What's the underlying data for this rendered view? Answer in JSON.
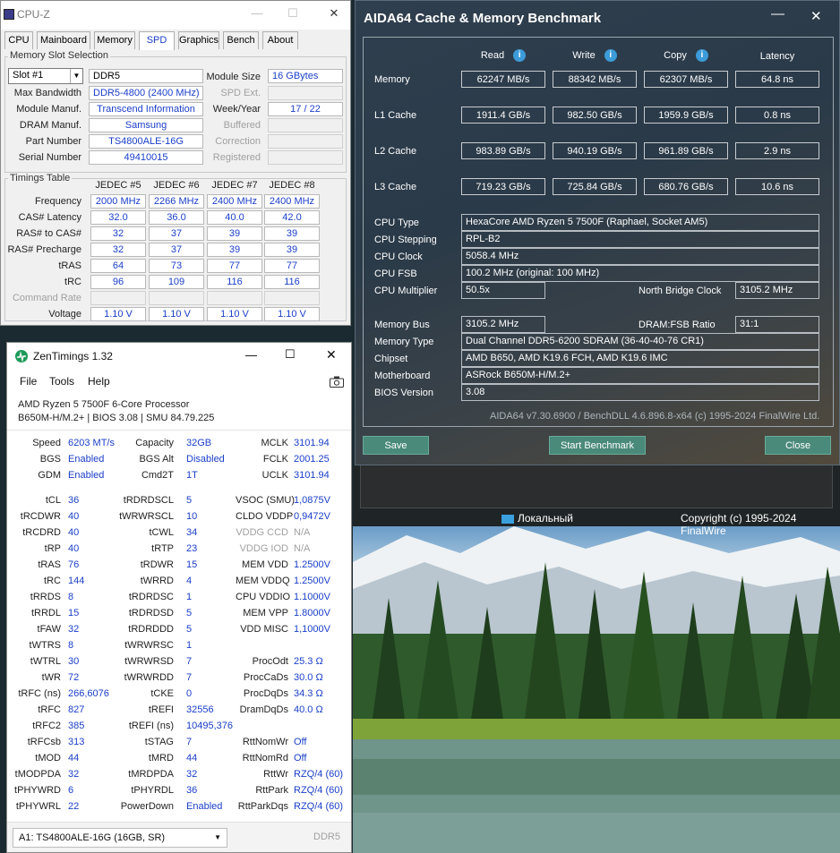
{
  "cpuz": {
    "title": "CPU-Z",
    "tabs": [
      "CPU",
      "Mainboard",
      "Memory",
      "SPD",
      "Graphics",
      "Bench",
      "About"
    ],
    "slot_group": "Memory Slot Selection",
    "slot": "Slot #1",
    "module_type": "DDR5",
    "labels": {
      "module_size": "Module Size",
      "max_bw": "Max Bandwidth",
      "spd_ext": "SPD Ext.",
      "manuf": "Module Manuf.",
      "week": "Week/Year",
      "dram": "DRAM Manuf.",
      "buffered": "Buffered",
      "part": "Part Number",
      "correction": "Correction",
      "serial": "Serial Number",
      "registered": "Registered"
    },
    "module_size": "16 GBytes",
    "max_bw": "DDR5-4800 (2400 MHz)",
    "manuf": "Transcend Information",
    "week": "17 / 22",
    "dram": "Samsung",
    "part": "TS4800ALE-16G",
    "serial": "49410015",
    "timings_group": "Timings Table",
    "cols": [
      "JEDEC #5",
      "JEDEC #6",
      "JEDEC #7",
      "JEDEC #8"
    ],
    "rows": [
      {
        "label": "Frequency",
        "vals": [
          "2000 MHz",
          "2266 MHz",
          "2400 MHz",
          "2400 MHz"
        ]
      },
      {
        "label": "CAS# Latency",
        "vals": [
          "32.0",
          "36.0",
          "40.0",
          "42.0"
        ]
      },
      {
        "label": "RAS# to CAS#",
        "vals": [
          "32",
          "37",
          "39",
          "39"
        ]
      },
      {
        "label": "RAS# Precharge",
        "vals": [
          "32",
          "37",
          "39",
          "39"
        ]
      },
      {
        "label": "tRAS",
        "vals": [
          "64",
          "73",
          "77",
          "77"
        ]
      },
      {
        "label": "tRC",
        "vals": [
          "96",
          "109",
          "116",
          "116"
        ]
      },
      {
        "label": "Command Rate",
        "vals": [
          "",
          "",
          "",
          ""
        ]
      },
      {
        "label": "Voltage",
        "vals": [
          "1.10 V",
          "1.10 V",
          "1.10 V",
          "1.10 V"
        ]
      }
    ]
  },
  "aida": {
    "title": "AIDA64 Cache & Memory Benchmark",
    "headers": [
      "Read",
      "Write",
      "Copy",
      "Latency"
    ],
    "bench": [
      {
        "label": "Memory",
        "vals": [
          "62247 MB/s",
          "88342 MB/s",
          "62307 MB/s",
          "64.8 ns"
        ]
      },
      {
        "label": "L1 Cache",
        "vals": [
          "1911.4 GB/s",
          "982.50 GB/s",
          "1959.9 GB/s",
          "0.8 ns"
        ]
      },
      {
        "label": "L2 Cache",
        "vals": [
          "983.89 GB/s",
          "940.19 GB/s",
          "961.89 GB/s",
          "2.9 ns"
        ]
      },
      {
        "label": "L3 Cache",
        "vals": [
          "719.23 GB/s",
          "725.84 GB/s",
          "680.76 GB/s",
          "10.6 ns"
        ]
      }
    ],
    "cpu_type_l": "CPU Type",
    "cpu_type": "HexaCore AMD Ryzen 5 7500F  (Raphael, Socket AM5)",
    "cpu_step_l": "CPU Stepping",
    "cpu_step": "RPL-B2",
    "cpu_clock_l": "CPU Clock",
    "cpu_clock": "5058.4 MHz",
    "cpu_fsb_l": "CPU FSB",
    "cpu_fsb": "100.2 MHz  (original: 100 MHz)",
    "cpu_mult_l": "CPU Multiplier",
    "cpu_mult": "50.5x",
    "nb_l": "North Bridge Clock",
    "nb": "3105.2 MHz",
    "mem_bus_l": "Memory Bus",
    "mem_bus": "3105.2 MHz",
    "ratio_l": "DRAM:FSB Ratio",
    "ratio": "31:1",
    "mem_type_l": "Memory Type",
    "mem_type": "Dual Channel DDR5-6200 SDRAM  (36-40-40-76 CR1)",
    "chipset_l": "Chipset",
    "chipset": "AMD B650, AMD K19.6 FCH, AMD K19.6 IMC",
    "mobo_l": "Motherboard",
    "mobo": "ASRock B650M-H/M.2+",
    "bios_l": "BIOS Version",
    "bios": "3.08",
    "version": "AIDA64 v7.30.6900 / BenchDLL 4.6.896.8-x64  (c) 1995-2024 FinalWire Ltd.",
    "save": "Save",
    "start": "Start Benchmark",
    "close": "Close"
  },
  "desktop": {
    "network": "Локальный",
    "copyright": "Copyright (c) 1995-2024 FinalWire"
  },
  "zen": {
    "title": "ZenTimings 1.32",
    "menu": [
      "File",
      "Tools",
      "Help"
    ],
    "cpu": "AMD Ryzen 5 7500F 6-Core Processor",
    "board": "B650M-H/M.2+ | BIOS 3.08 | SMU 84.79.225",
    "top": [
      [
        "Speed",
        "6203 MT/s",
        "Capacity",
        "32GB",
        "MCLK",
        "3101.94"
      ],
      [
        "BGS",
        "Enabled",
        "BGS Alt",
        "Disabled",
        "FCLK",
        "2001.25"
      ],
      [
        "GDM",
        "Enabled",
        "Cmd2T",
        "1T",
        "UCLK",
        "3101.94"
      ]
    ],
    "rows": [
      [
        "tCL",
        "36",
        "tRDRDSCL",
        "5",
        "VSOC (SMU)",
        "1,0875V"
      ],
      [
        "tRCDWR",
        "40",
        "tWRWRSCL",
        "10",
        "CLDO VDDP",
        "0,9472V"
      ],
      [
        "tRCDRD",
        "40",
        "tCWL",
        "34",
        "VDDG CCD",
        "N/A"
      ],
      [
        "tRP",
        "40",
        "tRTP",
        "23",
        "VDDG IOD",
        "N/A"
      ],
      [
        "tRAS",
        "76",
        "tRDWR",
        "15",
        "MEM VDD",
        "1.2500V"
      ],
      [
        "tRC",
        "144",
        "tWRRD",
        "4",
        "MEM VDDQ",
        "1.2500V"
      ],
      [
        "tRRDS",
        "8",
        "tRDRDSC",
        "1",
        "CPU VDDIO",
        "1.1000V"
      ],
      [
        "tRRDL",
        "15",
        "tRDRDSD",
        "5",
        "MEM VPP",
        "1.8000V"
      ],
      [
        "tFAW",
        "32",
        "tRDRDDD",
        "5",
        "VDD MISC",
        "1,1000V"
      ],
      [
        "tWTRS",
        "8",
        "tWRWRSC",
        "1",
        "",
        ""
      ],
      [
        "tWTRL",
        "30",
        "tWRWRSD",
        "7",
        "ProcOdt",
        "25.3 Ω"
      ],
      [
        "tWR",
        "72",
        "tWRWRDD",
        "7",
        "ProcCaDs",
        "30.0 Ω"
      ],
      [
        "tRFC (ns)",
        "266,6076",
        "tCKE",
        "0",
        "ProcDqDs",
        "34.3 Ω"
      ],
      [
        "tRFC",
        "827",
        "tREFI",
        "32556",
        "DramDqDs",
        "40.0 Ω"
      ],
      [
        "tRFC2",
        "385",
        "tREFI (ns)",
        "10495,376",
        "",
        ""
      ],
      [
        "tRFCsb",
        "313",
        "tSTAG",
        "7",
        "RttNomWr",
        "Off"
      ],
      [
        "tMOD",
        "44",
        "tMRD",
        "44",
        "RttNomRd",
        "Off"
      ],
      [
        "tMODPDA",
        "32",
        "tMRDPDA",
        "32",
        "RttWr",
        "RZQ/4 (60)"
      ],
      [
        "tPHYWRD",
        "6",
        "tPHYRDL",
        "36",
        "RttPark",
        "RZQ/4 (60)"
      ],
      [
        "tPHYWRL",
        "22",
        "PowerDown",
        "Enabled",
        "RttParkDqs",
        "RZQ/4 (60)"
      ]
    ],
    "module": "A1: TS4800ALE-16G (16GB, SR)",
    "mtype": "DDR5"
  }
}
